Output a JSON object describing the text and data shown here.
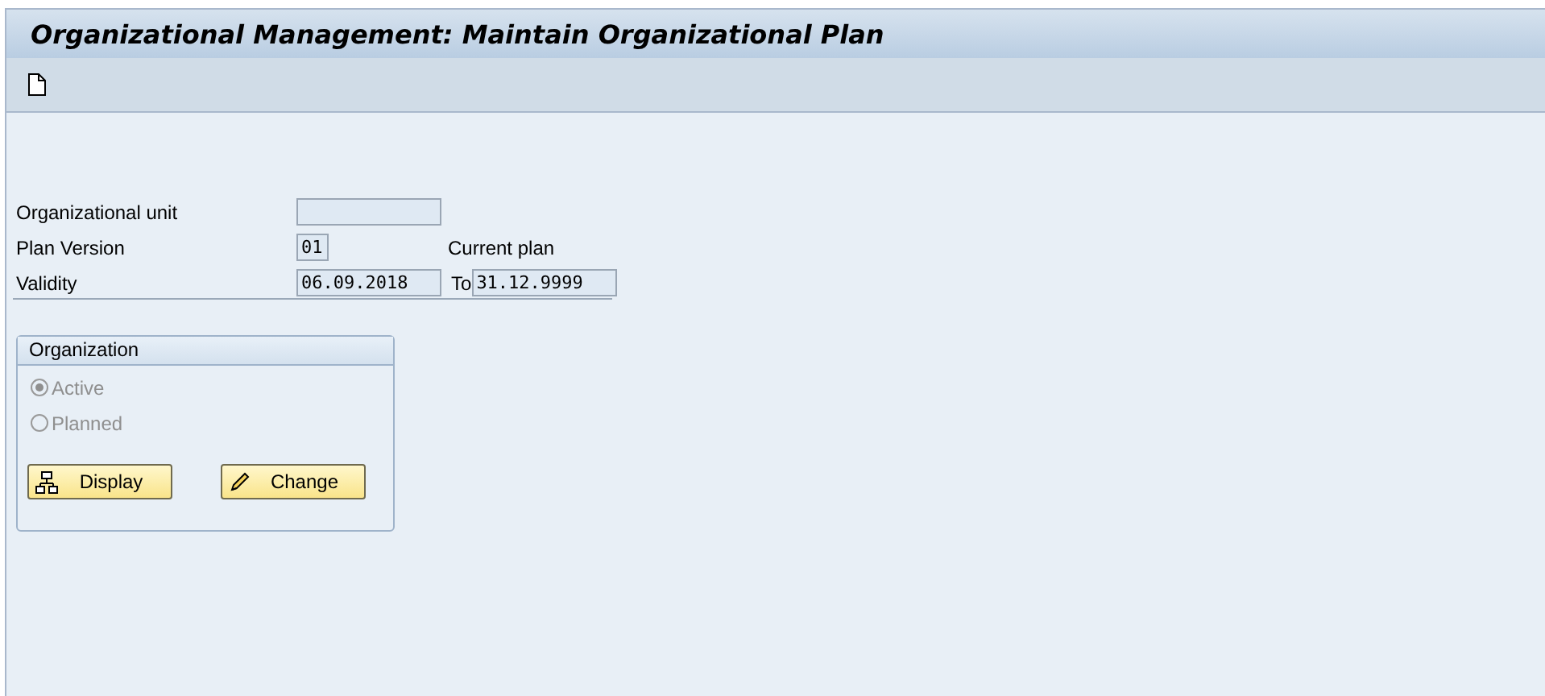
{
  "window": {
    "title": "Organizational Management: Maintain Organizational Plan"
  },
  "fields": [
    {
      "label": "Organizational unit"
    },
    {
      "label": "Plan Version",
      "value": "01",
      "description": "Current plan"
    },
    {
      "label": "Validity",
      "value": "06.09.2018",
      "to_label": "To",
      "to_value": "31.12.9999"
    }
  ],
  "group": {
    "title": "Organization",
    "options": [
      {
        "label": "Active",
        "selected": true,
        "disabled": true
      },
      {
        "label": "Planned",
        "selected": false,
        "disabled": true
      }
    ],
    "buttons": [
      {
        "label": "Display",
        "kind": "hierarchy"
      },
      {
        "label": "Change",
        "kind": "pencil"
      }
    ]
  }
}
